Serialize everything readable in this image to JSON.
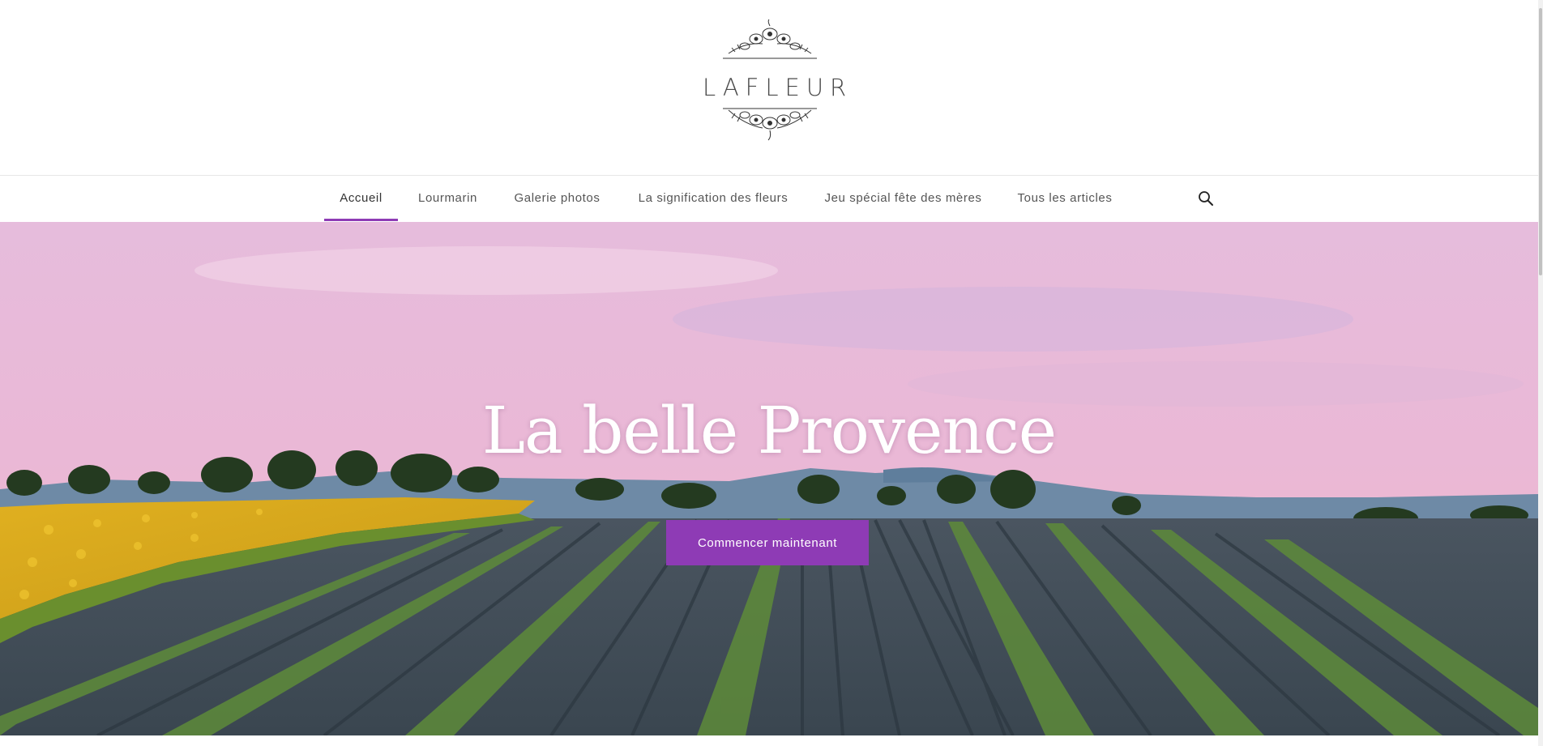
{
  "site": {
    "logo_text": "LAFLEUR"
  },
  "nav": {
    "items": [
      {
        "label": "Accueil",
        "active": true
      },
      {
        "label": "Lourmarin",
        "active": false
      },
      {
        "label": "Galerie photos",
        "active": false
      },
      {
        "label": "La signification des fleurs",
        "active": false
      },
      {
        "label": "Jeu spécial fête des mères",
        "active": false
      },
      {
        "label": "Tous les articles",
        "active": false
      }
    ],
    "search_icon": "search-icon"
  },
  "hero": {
    "title": "La belle Provence",
    "button_label": "Commencer maintenant"
  },
  "colors": {
    "accent": "#8e3bb5",
    "text": "#555555",
    "sky_top": "#e8b9d8",
    "sky_bottom": "#f2b3c8"
  }
}
